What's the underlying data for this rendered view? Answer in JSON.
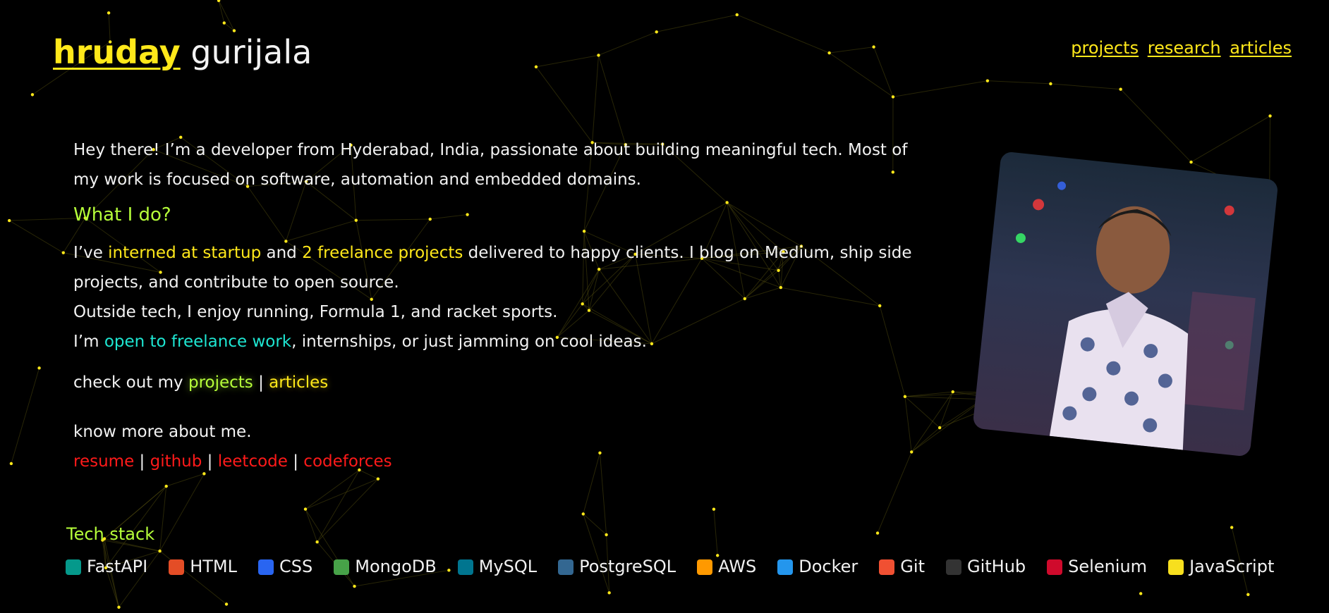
{
  "header": {
    "brand_first": "hruday",
    "brand_last": "gurijala",
    "nav": [
      "projects",
      "research",
      "articles"
    ]
  },
  "intro": {
    "line1": "Hey there! I’m a developer from Hyderabad, India, passionate about building meaningful tech. Most of",
    "line2": "my work is focused on software, automation and embedded domains."
  },
  "what_i_do": {
    "heading": "What I do?",
    "p1_a": "I’ve ",
    "p1_link1": "interned at startup",
    "p1_b": " and ",
    "p1_link2": "2 freelance projects",
    "p1_c": " delivered to happy clients. I blog on Medium, ship side",
    "p1_line2": "projects, and contribute to open source.",
    "p2": "Outside tech, I enjoy running, Formula 1, and racket sports.",
    "p3_a": "I’m ",
    "p3_link": "open to freelance work",
    "p3_b": ", internships, or just jamming on cool ideas."
  },
  "checkout": {
    "prefix": "check out my ",
    "projects": "projects",
    "sep": " | ",
    "articles": "articles"
  },
  "more": {
    "heading": "know more about me.",
    "links": [
      "resume",
      "github",
      "leetcode",
      "codeforces"
    ],
    "sep": " | "
  },
  "tech_stack": {
    "title": "Tech stack",
    "items": [
      {
        "name": "FastAPI",
        "icon": "fastapi-icon",
        "color": "#05998b"
      },
      {
        "name": "HTML",
        "icon": "html5-icon",
        "color": "#e44d26"
      },
      {
        "name": "CSS",
        "icon": "css3-icon",
        "color": "#2965f1"
      },
      {
        "name": "MongoDB",
        "icon": "mongodb-icon",
        "color": "#47a248"
      },
      {
        "name": "MySQL",
        "icon": "mysql-icon",
        "color": "#00758f"
      },
      {
        "name": "PostgreSQL",
        "icon": "postgresql-icon",
        "color": "#336791"
      },
      {
        "name": "AWS",
        "icon": "aws-icon",
        "color": "#ff9900"
      },
      {
        "name": "Docker",
        "icon": "docker-icon",
        "color": "#2496ed"
      },
      {
        "name": "Git",
        "icon": "git-icon",
        "color": "#f05032"
      },
      {
        "name": "GitHub",
        "icon": "github-icon",
        "color": "#333333"
      },
      {
        "name": "Selenium",
        "icon": "selenium-icon",
        "color": "#cf0a2c"
      },
      {
        "name": "JavaScript",
        "icon": "javascript-icon",
        "color": "#f7df1e"
      }
    ]
  },
  "colors": {
    "accent_yellow": "#ffe81a",
    "accent_green": "#b6ff3a",
    "accent_cyan": "#1ee6d2",
    "link_red": "#ff1a1a",
    "background": "#000000"
  }
}
